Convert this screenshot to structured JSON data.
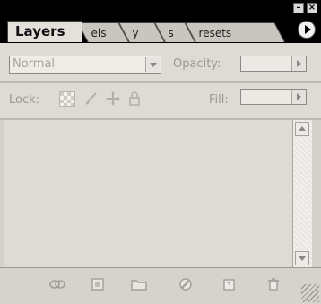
{
  "window": {
    "minimize_icon": "minimize-icon",
    "close_icon": "close-icon"
  },
  "tabs": [
    {
      "label": "Layers",
      "active": true
    },
    {
      "label": "els",
      "active": false
    },
    {
      "label": "y",
      "active": false
    },
    {
      "label": "s",
      "active": false
    },
    {
      "label": "resets",
      "active": false
    }
  ],
  "blend": {
    "value": "Normal"
  },
  "opacity": {
    "label": "Opacity:",
    "value": ""
  },
  "lock": {
    "label": "Lock:",
    "icons": [
      "lock-transparent-icon",
      "lock-image-icon",
      "lock-position-icon",
      "lock-all-icon"
    ]
  },
  "fill": {
    "label": "Fill:",
    "value": ""
  },
  "footer_icons": [
    "link-layers-icon",
    "layer-style-icon",
    "layer-mask-icon",
    "adjustment-layer-icon",
    "new-group-icon",
    "new-layer-icon",
    "delete-layer-icon"
  ],
  "colors": {
    "panel_bg": "#d4d1cb",
    "title_bg": "#000000",
    "active_tab": "#e4e1da"
  }
}
